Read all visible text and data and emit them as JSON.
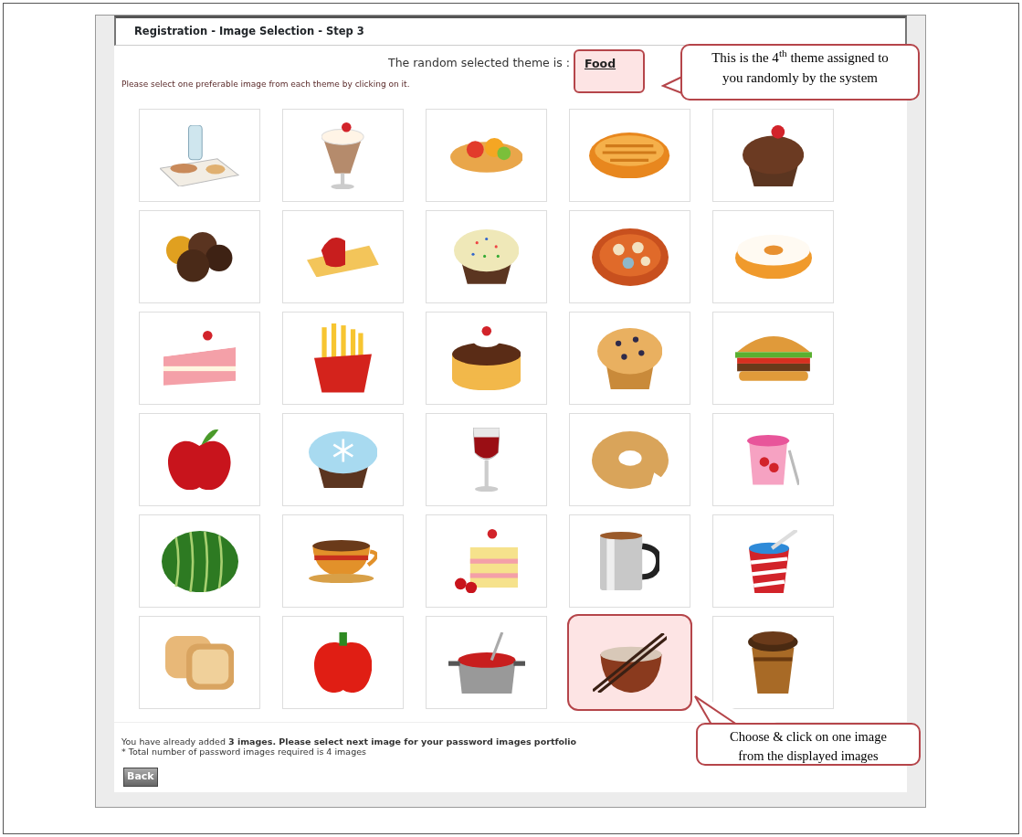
{
  "header": {
    "title": "Registration - Image Selection - Step 3"
  },
  "theme": {
    "label": "The random selected theme is :",
    "value": "Food"
  },
  "instruction": "Please select one preferable image from each theme by clicking on it.",
  "images": [
    {
      "kind": "picnic",
      "selected": false
    },
    {
      "kind": "milkshake",
      "selected": false
    },
    {
      "kind": "tart",
      "selected": false
    },
    {
      "kind": "pie",
      "selected": false
    },
    {
      "kind": "cupcake",
      "selected": false
    },
    {
      "kind": "chocolates",
      "selected": false
    },
    {
      "kind": "cheesecake",
      "selected": false
    },
    {
      "kind": "sprinklecake",
      "selected": false
    },
    {
      "kind": "cookies",
      "selected": false
    },
    {
      "kind": "donut",
      "selected": false
    },
    {
      "kind": "cakeslice",
      "selected": false
    },
    {
      "kind": "fries",
      "selected": false
    },
    {
      "kind": "chococake",
      "selected": false
    },
    {
      "kind": "muffin",
      "selected": false
    },
    {
      "kind": "burger",
      "selected": false
    },
    {
      "kind": "apple",
      "selected": false
    },
    {
      "kind": "frostcake",
      "selected": false
    },
    {
      "kind": "wine",
      "selected": false
    },
    {
      "kind": "bagel",
      "selected": false
    },
    {
      "kind": "yogurt",
      "selected": false
    },
    {
      "kind": "watermelon",
      "selected": false
    },
    {
      "kind": "teacup",
      "selected": false
    },
    {
      "kind": "shortcake",
      "selected": false
    },
    {
      "kind": "mug",
      "selected": false
    },
    {
      "kind": "soda",
      "selected": false
    },
    {
      "kind": "toast",
      "selected": false
    },
    {
      "kind": "pepper",
      "selected": false
    },
    {
      "kind": "pot",
      "selected": false
    },
    {
      "kind": "noodles",
      "selected": true
    },
    {
      "kind": "coffee",
      "selected": false
    }
  ],
  "status": {
    "line": "You have already added **3 images. Please select next image for your password images portfolio**",
    "note": "* Total number of password images required is 4 images"
  },
  "back_button": "Back",
  "annotations": [
    {
      "kind": "theme",
      "text": "This is the 4$^{th}$ theme assigned to you randomly  by the system"
    },
    {
      "kind": "choose",
      "text": "Choose & click  on one image from the displayed images"
    }
  ]
}
